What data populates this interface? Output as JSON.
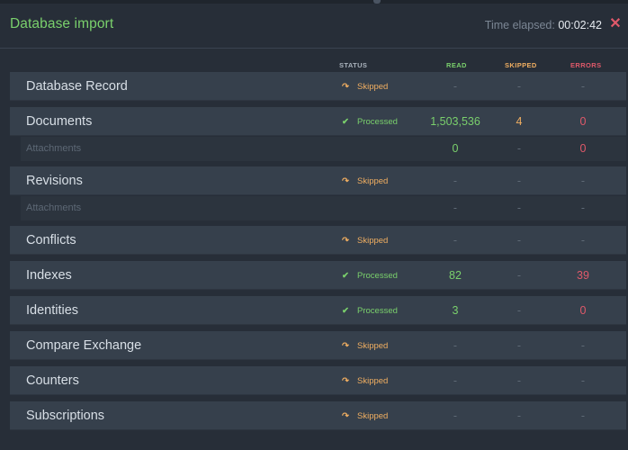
{
  "header": {
    "title": "Database import",
    "elapsed_label": "Time elapsed:",
    "elapsed_value": "00:02:42",
    "close_glyph": "✕"
  },
  "columns": {
    "status": "STATUS",
    "read": "READ",
    "skipped": "SKIPPED",
    "errors": "ERRORS"
  },
  "colors": {
    "green": "#7ad06c",
    "orange": "#f0ae61",
    "red": "#e0596a"
  },
  "rows": [
    {
      "name": "Database Record",
      "status": "Skipped",
      "status_icon": "redo-arrow-icon",
      "read": "-",
      "skipped": "-",
      "errors": "-"
    },
    {
      "name": "Documents",
      "status": "Processed",
      "status_icon": "check-icon",
      "read": "1,503,536",
      "skipped": "4",
      "errors": "0"
    },
    {
      "name": "Attachments",
      "sub": true,
      "read": "0",
      "skipped": "-",
      "errors": "0"
    },
    {
      "name": "Revisions",
      "status": "Skipped",
      "status_icon": "redo-arrow-icon",
      "read": "-",
      "skipped": "-",
      "errors": "-"
    },
    {
      "name": "Attachments",
      "sub": true,
      "read": "-",
      "skipped": "-",
      "errors": "-"
    },
    {
      "name": "Conflicts",
      "status": "Skipped",
      "status_icon": "redo-arrow-icon",
      "read": "-",
      "skipped": "-",
      "errors": "-"
    },
    {
      "name": "Indexes",
      "status": "Processed",
      "status_icon": "check-icon",
      "read": "82",
      "skipped": "-",
      "errors": "39"
    },
    {
      "name": "Identities",
      "status": "Processed",
      "status_icon": "check-icon",
      "read": "3",
      "skipped": "-",
      "errors": "0"
    },
    {
      "name": "Compare Exchange",
      "status": "Skipped",
      "status_icon": "redo-arrow-icon",
      "read": "-",
      "skipped": "-",
      "errors": "-"
    },
    {
      "name": "Counters",
      "status": "Skipped",
      "status_icon": "redo-arrow-icon",
      "read": "-",
      "skipped": "-",
      "errors": "-"
    },
    {
      "name": "Subscriptions",
      "status": "Skipped",
      "status_icon": "redo-arrow-icon",
      "read": "-",
      "skipped": "-",
      "errors": "-"
    }
  ]
}
